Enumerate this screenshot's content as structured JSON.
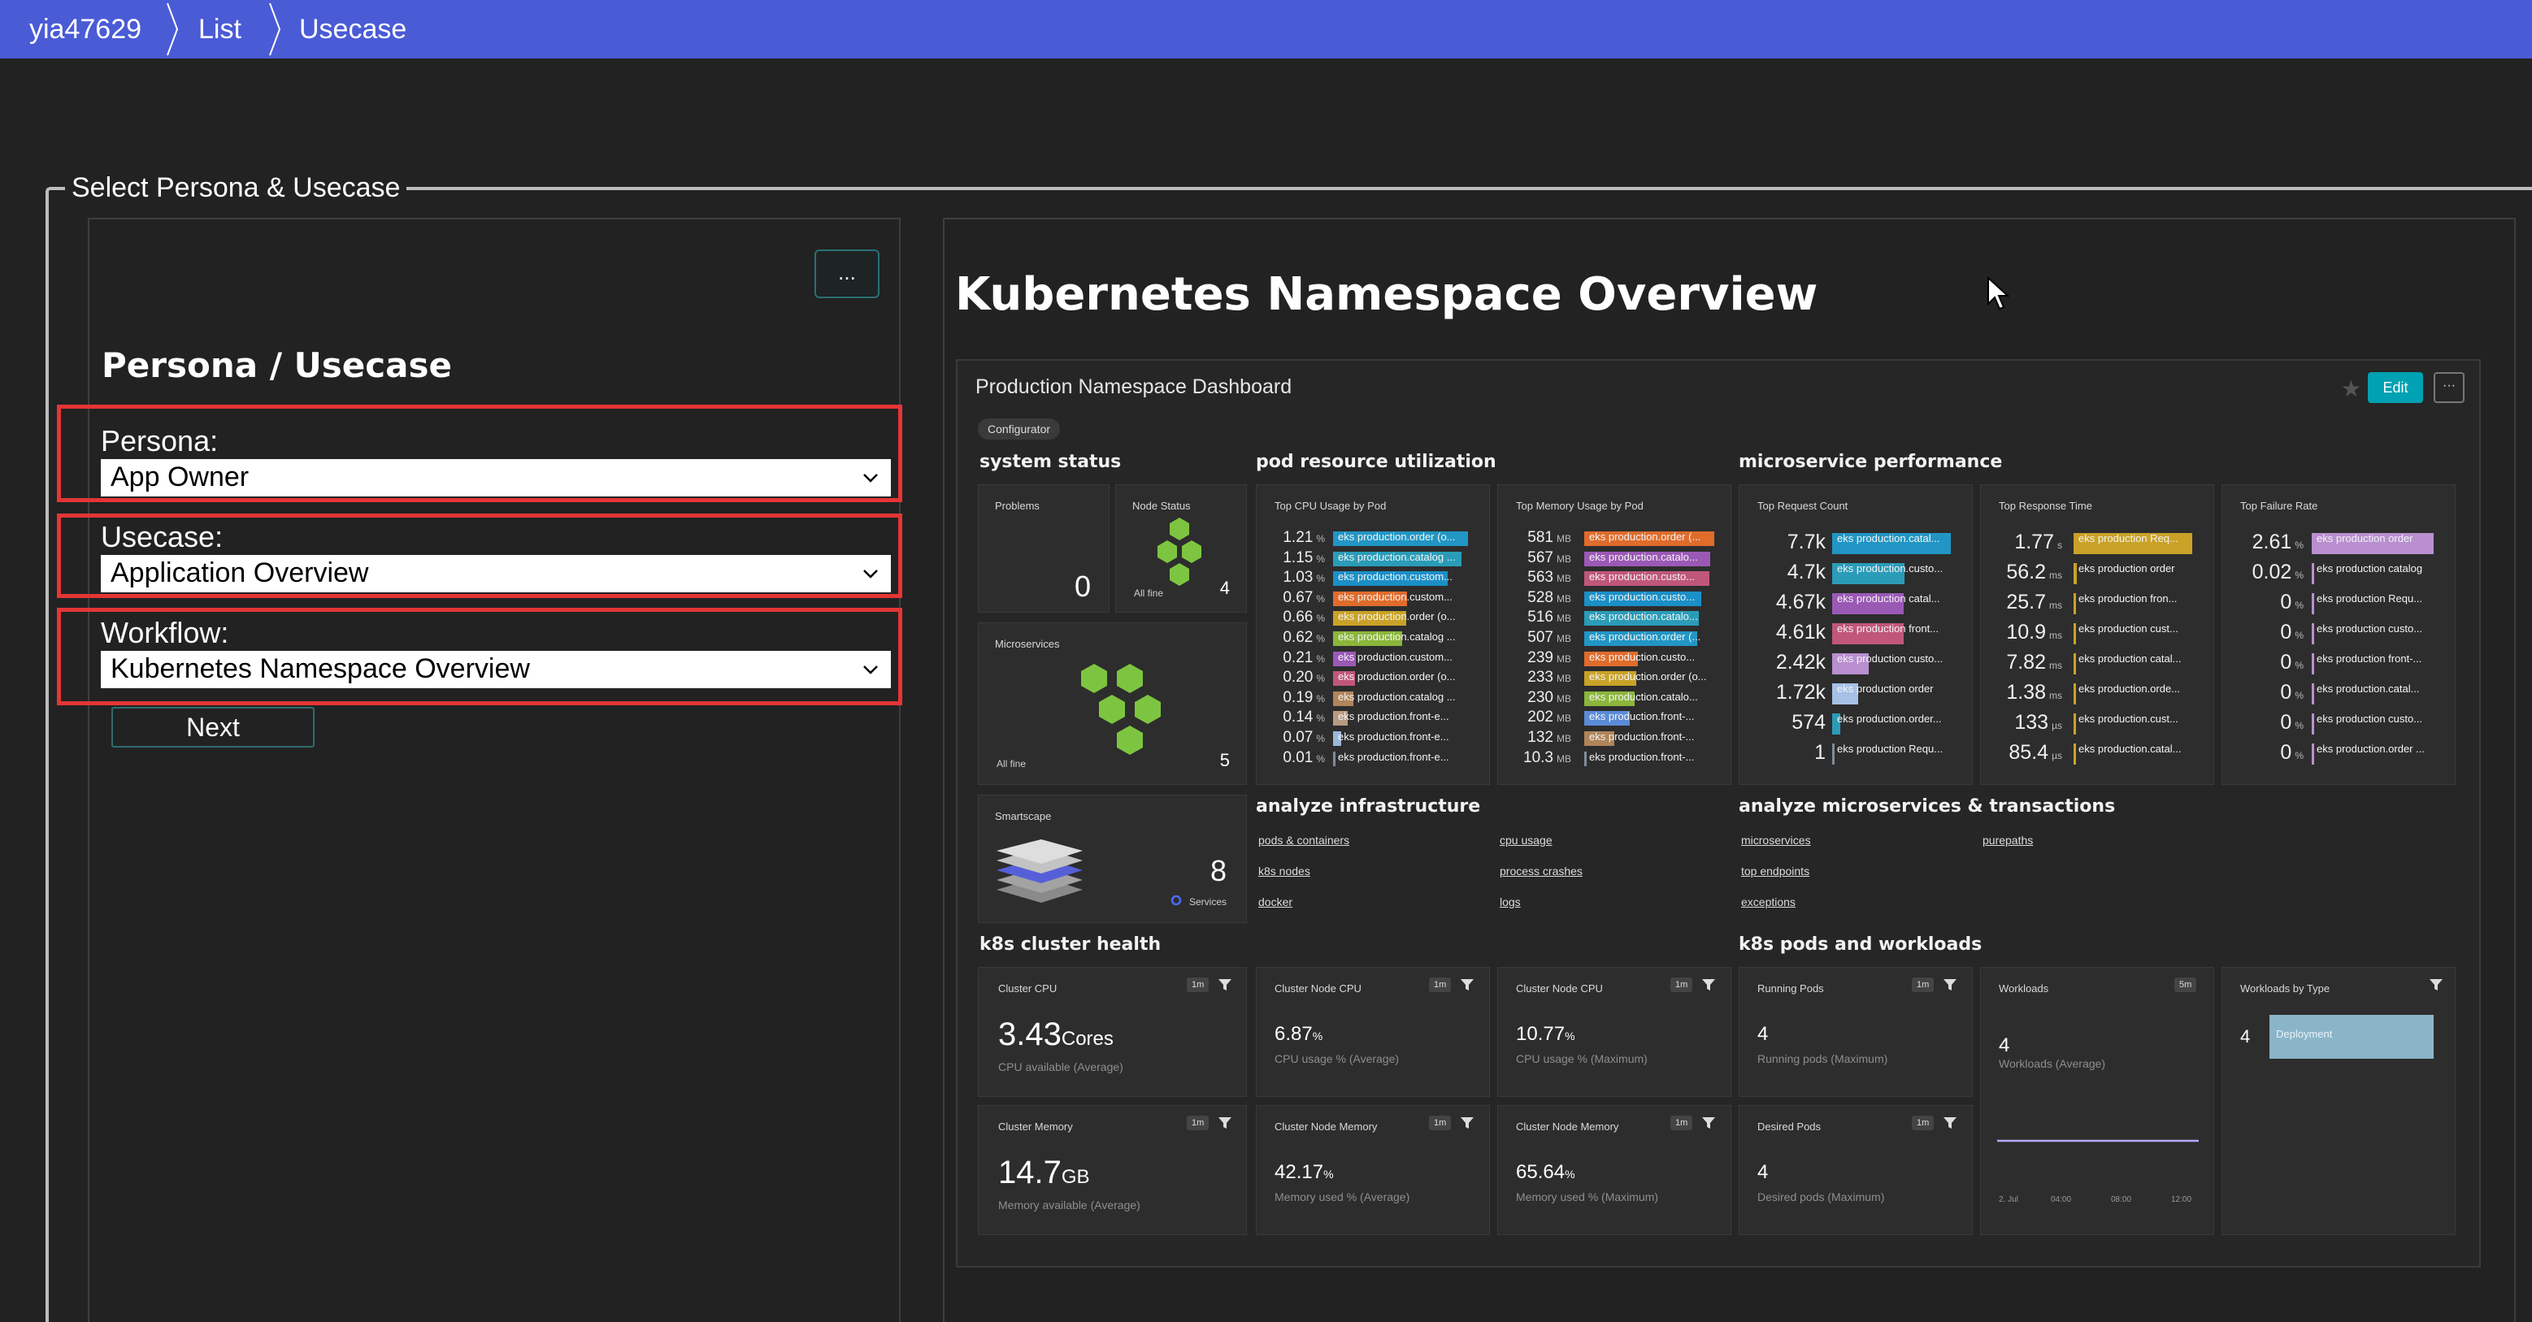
{
  "breadcrumb": [
    "yia47629",
    "List",
    "Usecase"
  ],
  "section_legend": "Select Persona & Usecase",
  "left_panel": {
    "more_button": "...",
    "title": "Persona / Usecase",
    "persona": {
      "label": "Persona:",
      "value": "App Owner"
    },
    "usecase": {
      "label": "Usecase:",
      "value": "Application Overview"
    },
    "workflow": {
      "label": "Workflow:",
      "value": "Kubernetes Namespace Overview"
    },
    "next_button": "Next"
  },
  "right_panel": {
    "title": "Kubernetes Namespace Overview",
    "dashboard": {
      "title": "Production Namespace Dashboard",
      "edit_button": "Edit",
      "more_button": "···",
      "tag": "Configurator",
      "sections": {
        "system_status": "system status",
        "pod_resource": "pod resource utilization",
        "microservice_perf": "microservice performance",
        "analyze_infra": "analyze infrastructure",
        "analyze_micro": "analyze microservices & transactions",
        "k8s_cluster": "k8s cluster health",
        "k8s_pods": "k8s pods and workloads"
      },
      "problems": {
        "title": "Problems",
        "value": "0"
      },
      "node_status": {
        "title": "Node Status",
        "caption": "All fine",
        "count": "4"
      },
      "microservices": {
        "title": "Microservices",
        "caption": "All fine",
        "count": "5"
      },
      "smartscape": {
        "title": "Smartscape",
        "count": "8",
        "caption": "Services"
      },
      "cpu_by_pod": {
        "title": "Top CPU Usage by Pod",
        "unit": "%",
        "rows": [
          {
            "value": "1.21",
            "label": "eks production.order (o...",
            "color": "#2196c4",
            "fill": 1.0
          },
          {
            "value": "1.15",
            "label": "eks production.catalog ...",
            "color": "#2a9cb8",
            "fill": 0.95
          },
          {
            "value": "1.03",
            "label": "eks production.custom...",
            "color": "#1b8fc7",
            "fill": 0.85
          },
          {
            "value": "0.67",
            "label": "eks production.custom...",
            "color": "#e06c2b",
            "fill": 0.55
          },
          {
            "value": "0.66",
            "label": "eks production.order (o...",
            "color": "#c9a227",
            "fill": 0.54
          },
          {
            "value": "0.62",
            "label": "eks production.catalog ...",
            "color": "#8bb63b",
            "fill": 0.51
          },
          {
            "value": "0.21",
            "label": "eks production.custom...",
            "color": "#9b59b6",
            "fill": 0.17
          },
          {
            "value": "0.20",
            "label": "eks production.order (o...",
            "color": "#c0577a",
            "fill": 0.16
          },
          {
            "value": "0.19",
            "label": "eks production.catalog ...",
            "color": "#b0855a",
            "fill": 0.15
          },
          {
            "value": "0.14",
            "label": "eks production.front-e...",
            "color": "#b89b80",
            "fill": 0.11
          },
          {
            "value": "0.07",
            "label": "eks production.front-e...",
            "color": "#9ab8d8",
            "fill": 0.06
          },
          {
            "value": "0.01",
            "label": "eks production.front-e...",
            "color": "#7f8c99",
            "fill": 0.01
          }
        ]
      },
      "mem_by_pod": {
        "title": "Top Memory Usage by Pod",
        "unit": "MB",
        "rows": [
          {
            "value": "581",
            "label": "eks production.order (...",
            "color": "#e06c2b",
            "fill": 1.0
          },
          {
            "value": "567",
            "label": "eks production.catalo...",
            "color": "#9b59b6",
            "fill": 0.97
          },
          {
            "value": "563",
            "label": "eks production.custo...",
            "color": "#c0577a",
            "fill": 0.96
          },
          {
            "value": "528",
            "label": "eks production.custo...",
            "color": "#1b8fc7",
            "fill": 0.9
          },
          {
            "value": "516",
            "label": "eks production.catalo...",
            "color": "#2a9cb8",
            "fill": 0.88
          },
          {
            "value": "507",
            "label": "eks production.order (...",
            "color": "#2196c4",
            "fill": 0.87
          },
          {
            "value": "239",
            "label": "eks production.custo...",
            "color": "#e06c2b",
            "fill": 0.41
          },
          {
            "value": "233",
            "label": "eks production.order (o...",
            "color": "#c9a227",
            "fill": 0.4
          },
          {
            "value": "230",
            "label": "eks production.catalo...",
            "color": "#8bb63b",
            "fill": 0.39
          },
          {
            "value": "202",
            "label": "eks production.front-...",
            "color": "#5b8bd6",
            "fill": 0.35
          },
          {
            "value": "132",
            "label": "eks production.front-...",
            "color": "#b0855a",
            "fill": 0.23
          },
          {
            "value": "10.3",
            "label": "eks production.front-...",
            "color": "#7f8c99",
            "fill": 0.02
          }
        ]
      },
      "request_count": {
        "title": "Top Request Count",
        "rows": [
          {
            "value": "7.7k",
            "unit": "",
            "label": "eks production.catal...",
            "color": "#2196c4",
            "fill": 1.0
          },
          {
            "value": "4.7k",
            "unit": "",
            "label": "eks production.custo...",
            "color": "#2a9cb8",
            "fill": 0.61
          },
          {
            "value": "4.67k",
            "unit": "",
            "label": "eks production catal...",
            "color": "#9b59b6",
            "fill": 0.6
          },
          {
            "value": "4.61k",
            "unit": "",
            "label": "eks production front...",
            "color": "#c0577a",
            "fill": 0.6
          },
          {
            "value": "2.42k",
            "unit": "",
            "label": "eks production custo...",
            "color": "#b98fd0",
            "fill": 0.31
          },
          {
            "value": "1.72k",
            "unit": "",
            "label": "eks production order",
            "color": "#a6c1e6",
            "fill": 0.22
          },
          {
            "value": "574",
            "unit": "",
            "label": "eks production.order...",
            "color": "#2a9cb8",
            "fill": 0.07
          },
          {
            "value": "1",
            "unit": "",
            "label": "eks production Requ...",
            "color": "#7f8c99",
            "fill": 0.0
          }
        ]
      },
      "response_time": {
        "title": "Top Response Time",
        "rows": [
          {
            "value": "1.77",
            "unit": "s",
            "label": "eks production Req...",
            "color": "#c9a227",
            "fill": 1.0
          },
          {
            "value": "56.2",
            "unit": "ms",
            "label": "eks production order",
            "color": "#c9a227",
            "fill": 0.03
          },
          {
            "value": "25.7",
            "unit": "ms",
            "label": "eks production fron...",
            "color": "#c9a227",
            "fill": 0.015
          },
          {
            "value": "10.9",
            "unit": "ms",
            "label": "eks production cust...",
            "color": "#c9a227",
            "fill": 0.006
          },
          {
            "value": "7.82",
            "unit": "ms",
            "label": "eks production catal...",
            "color": "#c9a227",
            "fill": 0.004
          },
          {
            "value": "1.38",
            "unit": "ms",
            "label": "eks production.orde...",
            "color": "#c9a227",
            "fill": 0.001
          },
          {
            "value": "133",
            "unit": "µs",
            "label": "eks production.cust...",
            "color": "#c9a227",
            "fill": 0.0
          },
          {
            "value": "85.4",
            "unit": "µs",
            "label": "eks production.catal...",
            "color": "#c9a227",
            "fill": 0.0
          }
        ]
      },
      "failure_rate": {
        "title": "Top Failure Rate",
        "rows": [
          {
            "value": "2.61",
            "unit": "%",
            "label": "eks production order",
            "color": "#b98fd0",
            "fill": 1.0
          },
          {
            "value": "0.02",
            "unit": "%",
            "label": "eks production catalog",
            "color": "#b98fd0",
            "fill": 0.01
          },
          {
            "value": "0",
            "unit": "%",
            "label": "eks production Requ...",
            "color": "#b98fd0",
            "fill": 0.0
          },
          {
            "value": "0",
            "unit": "%",
            "label": "eks production custo...",
            "color": "#b98fd0",
            "fill": 0.0
          },
          {
            "value": "0",
            "unit": "%",
            "label": "eks production front-...",
            "color": "#b98fd0",
            "fill": 0.0
          },
          {
            "value": "0",
            "unit": "%",
            "label": "eks production.catal...",
            "color": "#b98fd0",
            "fill": 0.0
          },
          {
            "value": "0",
            "unit": "%",
            "label": "eks production custo...",
            "color": "#b98fd0",
            "fill": 0.0
          },
          {
            "value": "0",
            "unit": "%",
            "label": "eks production.order ...",
            "color": "#b98fd0",
            "fill": 0.0
          }
        ]
      },
      "infra_links": [
        "pods & containers",
        "k8s nodes",
        "docker",
        "cpu usage",
        "process crashes",
        "logs"
      ],
      "micro_links": [
        "microservices",
        "top endpoints",
        "exceptions",
        "purepaths"
      ],
      "cluster_cpu": {
        "title": "Cluster CPU",
        "badge": "1m",
        "value": "3.43",
        "unit": "Cores",
        "caption": "CPU available (Average)"
      },
      "cluster_memory": {
        "title": "Cluster Memory",
        "badge": "1m",
        "value": "14.7",
        "unit": "GB",
        "caption": "Memory available (Average)"
      },
      "node_cpu_avg": {
        "title": "Cluster Node CPU",
        "badge": "1m",
        "value": "6.87",
        "unit": "%",
        "caption": "CPU usage % (Average)"
      },
      "node_mem_avg": {
        "title": "Cluster Node Memory",
        "badge": "1m",
        "value": "42.17",
        "unit": "%",
        "caption": "Memory used % (Average)"
      },
      "node_cpu_max": {
        "title": "Cluster Node CPU",
        "badge": "1m",
        "value": "10.77",
        "unit": "%",
        "caption": "CPU usage % (Maximum)"
      },
      "node_mem_max": {
        "title": "Cluster Node Memory",
        "badge": "1m",
        "value": "65.64",
        "unit": "%",
        "caption": "Memory used % (Maximum)"
      },
      "running_pods": {
        "title": "Running Pods",
        "badge": "1m",
        "value": "4",
        "caption": "Running pods (Maximum)"
      },
      "desired_pods": {
        "title": "Desired Pods",
        "badge": "1m",
        "value": "4",
        "caption": "Desired pods (Maximum)"
      },
      "workloads": {
        "title": "Workloads",
        "badge": "5m",
        "value": "4",
        "caption": "Workloads (Average)",
        "x_ticks": [
          "2. Jul",
          "04:00",
          "08:00",
          "12:00"
        ]
      },
      "workloads_by_type": {
        "title": "Workloads by Type",
        "value": "4",
        "bar_label": "Deployment"
      }
    }
  }
}
